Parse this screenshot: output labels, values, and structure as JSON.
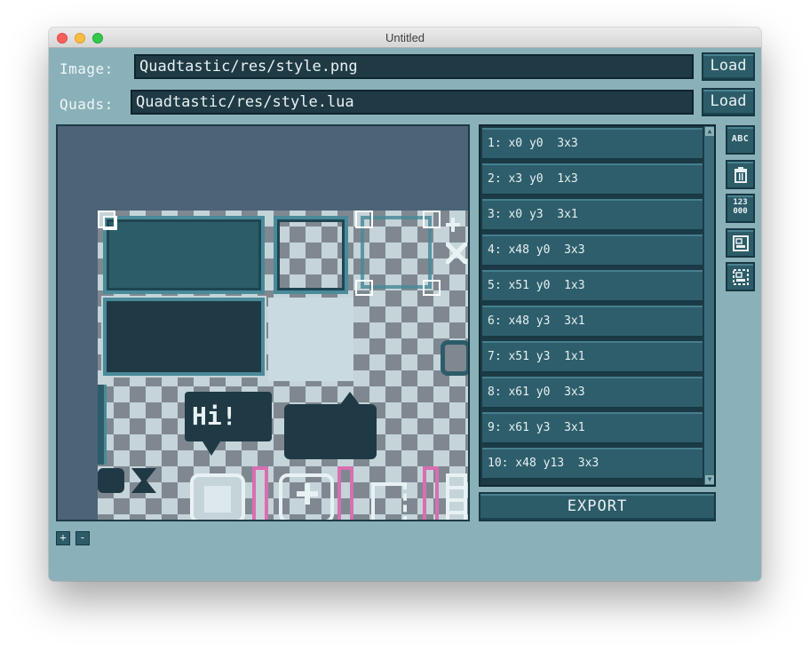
{
  "window": {
    "title": "Untitled"
  },
  "image_row": {
    "label": "Image:",
    "path": "Quadtastic/res/style.png",
    "load_label": "Load"
  },
  "quads_row": {
    "label": "Quads:",
    "path": "Quadtastic/res/style.lua",
    "load_label": "Load"
  },
  "canvas": {
    "sprite_text": "Hi!"
  },
  "quad_list": {
    "items": [
      {
        "label": "1: x0 y0  3x3"
      },
      {
        "label": "2: x3 y0  1x3"
      },
      {
        "label": "3: x0 y3  3x1"
      },
      {
        "label": "4: x48 y0  3x3"
      },
      {
        "label": "5: x51 y0  1x3"
      },
      {
        "label": "6: x48 y3  3x1"
      },
      {
        "label": "7: x51 y3  1x1"
      },
      {
        "label": "8: x61 y0  3x3"
      },
      {
        "label": "9: x61 y3  3x1"
      },
      {
        "label": "10: x48 y13  3x3"
      }
    ]
  },
  "export_label": "EXPORT",
  "tools": {
    "rename_text": "ABC",
    "sort_text_top": "123",
    "sort_text_bottom": "000"
  },
  "zoom": {
    "in_label": "+",
    "out_label": "-"
  },
  "colors": {
    "window_bg": "#8ab1b9",
    "field_bg": "#1f3a45",
    "button_bg": "#2d5c69",
    "canvas_bg": "#4c6378",
    "accent_pink": "#d86fb0"
  }
}
